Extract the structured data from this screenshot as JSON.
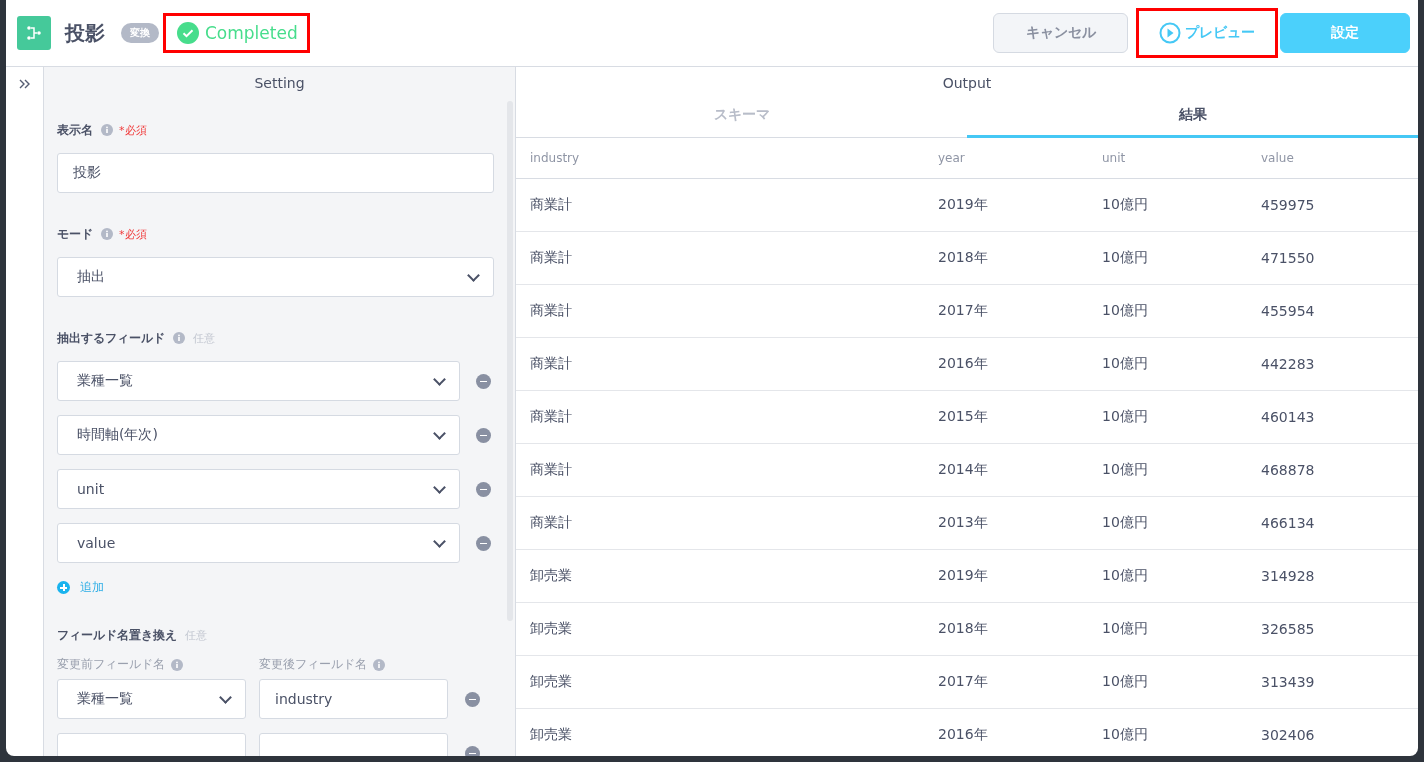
{
  "header": {
    "title": "投影",
    "badge": "変換",
    "status": {
      "label": "Completed",
      "highlighted": true
    },
    "buttons": [
      {
        "label": "キャンセル",
        "kind": "secondary",
        "highlighted": false
      },
      {
        "label": "プレビュー",
        "kind": "preview",
        "highlighted": true
      },
      {
        "label": "設定",
        "kind": "primary",
        "highlighted": false
      }
    ]
  },
  "setting": {
    "title": "Setting",
    "display_name": {
      "label": "表示名",
      "required": "*必須",
      "value": "投影"
    },
    "mode": {
      "label": "モード",
      "required": "*必須",
      "value": "抽出"
    },
    "fields": {
      "label": "抽出するフィールド",
      "optional": "任意",
      "items": [
        "業種一覧",
        "時間軸(年次)",
        "unit",
        "value"
      ],
      "add": "追加"
    },
    "rename": {
      "label": "フィールド名置き換え",
      "optional": "任意",
      "before_label": "変更前フィールド名",
      "after_label": "変更後フィールド名",
      "rows": [
        {
          "before": "業種一覧",
          "after": "industry"
        },
        {
          "before": "",
          "after": ""
        }
      ]
    }
  },
  "output": {
    "title": "Output",
    "tabs": [
      {
        "label": "スキーマ",
        "selected": false
      },
      {
        "label": "結果",
        "selected": true
      }
    ],
    "table": {
      "columns": [
        "industry",
        "year",
        "unit",
        "value"
      ],
      "rows": [
        [
          "商業計",
          "2019年",
          "10億円",
          "459975"
        ],
        [
          "商業計",
          "2018年",
          "10億円",
          "471550"
        ],
        [
          "商業計",
          "2017年",
          "10億円",
          "455954"
        ],
        [
          "商業計",
          "2016年",
          "10億円",
          "442283"
        ],
        [
          "商業計",
          "2015年",
          "10億円",
          "460143"
        ],
        [
          "商業計",
          "2014年",
          "10億円",
          "468878"
        ],
        [
          "商業計",
          "2013年",
          "10億円",
          "466134"
        ],
        [
          "卸売業",
          "2019年",
          "10億円",
          "314928"
        ],
        [
          "卸売業",
          "2018年",
          "10億円",
          "326585"
        ],
        [
          "卸売業",
          "2017年",
          "10億円",
          "313439"
        ],
        [
          "卸売業",
          "2016年",
          "10億円",
          "302406"
        ]
      ]
    }
  }
}
